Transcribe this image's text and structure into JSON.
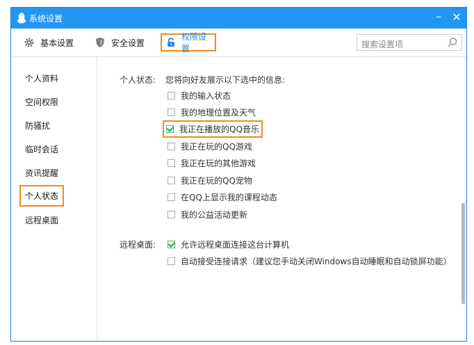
{
  "window": {
    "title": "系统设置",
    "accent": "#2196f3",
    "highlight": "#f08a1e"
  },
  "tabs": [
    {
      "label": "基本设置",
      "icon": "gear-icon"
    },
    {
      "label": "安全设置",
      "icon": "shield-icon"
    },
    {
      "label": "权限设置",
      "icon": "lock-icon",
      "active": true
    }
  ],
  "search": {
    "placeholder": "搜索设置项"
  },
  "sidebar": {
    "items": [
      {
        "label": "个人资料"
      },
      {
        "label": "空间权限"
      },
      {
        "label": "防骚扰"
      },
      {
        "label": "临时会话"
      },
      {
        "label": "资讯提醒"
      },
      {
        "label": "个人状态",
        "active": true
      },
      {
        "label": "远程桌面"
      }
    ]
  },
  "personal_status": {
    "label": "个人状态:",
    "description": "您将向好友展示以下选中的信息:",
    "options": [
      {
        "label": "我的输入状态",
        "checked": false
      },
      {
        "label": "我的地理位置及天气",
        "checked": false
      },
      {
        "label": "我正在播放的QQ音乐",
        "checked": true
      },
      {
        "label": "我正在玩的QQ游戏",
        "checked": false
      },
      {
        "label": "我正在玩的其他游戏",
        "checked": false
      },
      {
        "label": "我正在玩的QQ宠物",
        "checked": false
      },
      {
        "label": "在QQ上显示我的课程动态",
        "checked": false
      },
      {
        "label": "我的公益活动更新",
        "checked": false
      }
    ]
  },
  "remote_desktop": {
    "label": "远程桌面:",
    "options": [
      {
        "label": "允许远程桌面连接这台计算机",
        "checked": true
      },
      {
        "label": "自动接受连接请求（建议您手动关闭Windows自动睡眠和自动锁屏功能）",
        "checked": false
      }
    ]
  }
}
